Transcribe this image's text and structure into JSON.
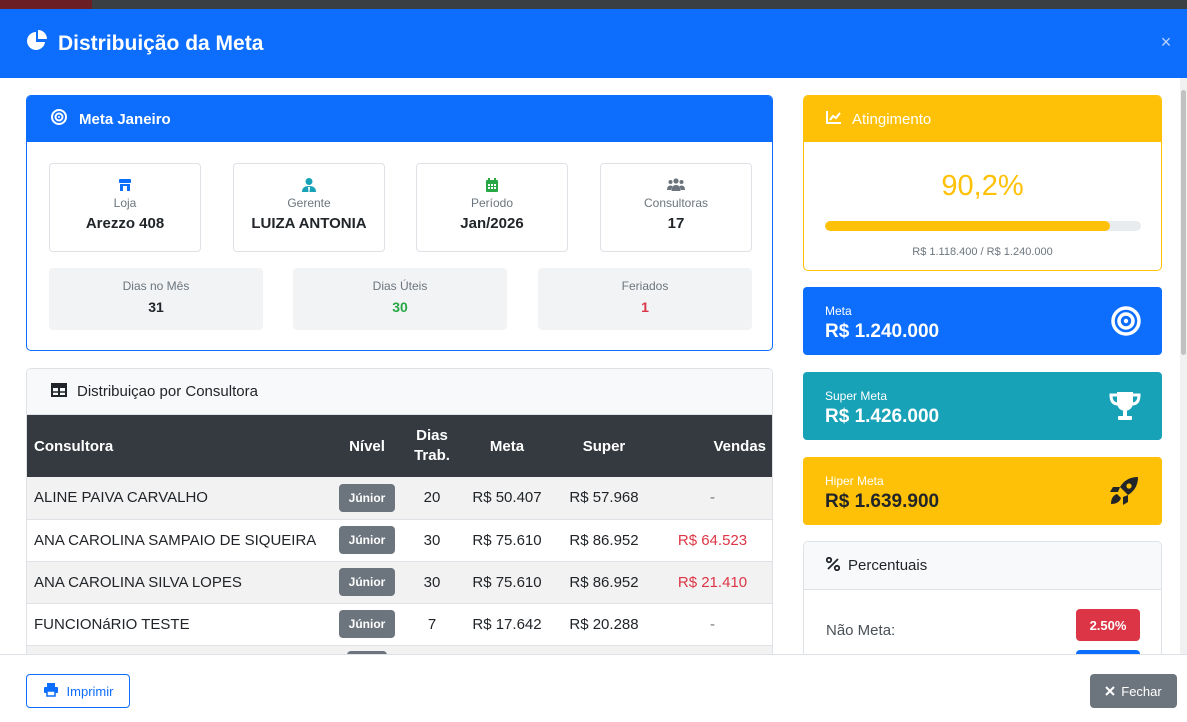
{
  "modal": {
    "title": "Distribuição da Meta",
    "close_symbol": "×"
  },
  "meta_card": {
    "title": "Meta Janeiro",
    "info": [
      {
        "label": "Loja",
        "value": "Arezzo 408",
        "icon": "store-icon",
        "color": "#0d6efd"
      },
      {
        "label": "Gerente",
        "value": "LUIZA ANTONIA",
        "icon": "user-tie-icon",
        "color": "#17a2b8"
      },
      {
        "label": "Período",
        "value": "Jan/2026",
        "icon": "calendar-icon",
        "color": "#28a745"
      },
      {
        "label": "Consultoras",
        "value": "17",
        "icon": "users-icon",
        "color": "#6c757d"
      }
    ],
    "days": [
      {
        "label": "Dias no Mês",
        "value": "31",
        "color": "#212529"
      },
      {
        "label": "Dias Úteis",
        "value": "30",
        "color": "#28a745"
      },
      {
        "label": "Feriados",
        "value": "1",
        "color": "#dc3545"
      }
    ]
  },
  "distribution": {
    "title": "Distribuiçao por Consultora",
    "columns": {
      "name": "Consultora",
      "level": "Nível",
      "days_1": "Dias",
      "days_2": "Trab.",
      "meta": "Meta",
      "super": "Super",
      "sales": "Vendas"
    },
    "rows": [
      {
        "name": "ALINE PAIVA CARVALHO",
        "level": "Júnior",
        "days": "20",
        "meta": "R$ 50.407",
        "super": "R$ 57.968",
        "sales": "-"
      },
      {
        "name": "ANA CAROLINA SAMPAIO DE SIQUEIRA",
        "level": "Júnior",
        "days": "30",
        "meta": "R$ 75.610",
        "super": "R$ 86.952",
        "sales": "R$ 64.523"
      },
      {
        "name": "ANA CAROLINA SILVA LOPES",
        "level": "Júnior",
        "days": "30",
        "meta": "R$ 75.610",
        "super": "R$ 86.952",
        "sales": "R$ 21.410"
      },
      {
        "name": "FUNCIONáRIO TESTE",
        "level": "Júnior",
        "days": "7",
        "meta": "R$ 17.642",
        "super": "R$ 20.288",
        "sales": "-"
      }
    ]
  },
  "attainment": {
    "title": "Atingimento",
    "percent_label": "90,2%",
    "progress": 0.902,
    "amount": "R$ 1.118.400 / R$ 1.240.000"
  },
  "goals": [
    {
      "label": "Meta",
      "value": "R$ 1.240.000",
      "icon": "target-icon",
      "bg": "#0d6efd"
    },
    {
      "label": "Super Meta",
      "value": "R$ 1.426.000",
      "icon": "trophy-icon",
      "bg": "#17a2b8"
    },
    {
      "label": "Hiper Meta",
      "value": "R$ 1.639.900",
      "icon": "rocket-icon",
      "bg": "#ffc107"
    }
  ],
  "percentuais": {
    "title": "Percentuais",
    "row_label": "Não Meta:",
    "row_value": "2.50%"
  },
  "footer": {
    "print_label": "Imprimir",
    "close_label": "Fechar"
  }
}
